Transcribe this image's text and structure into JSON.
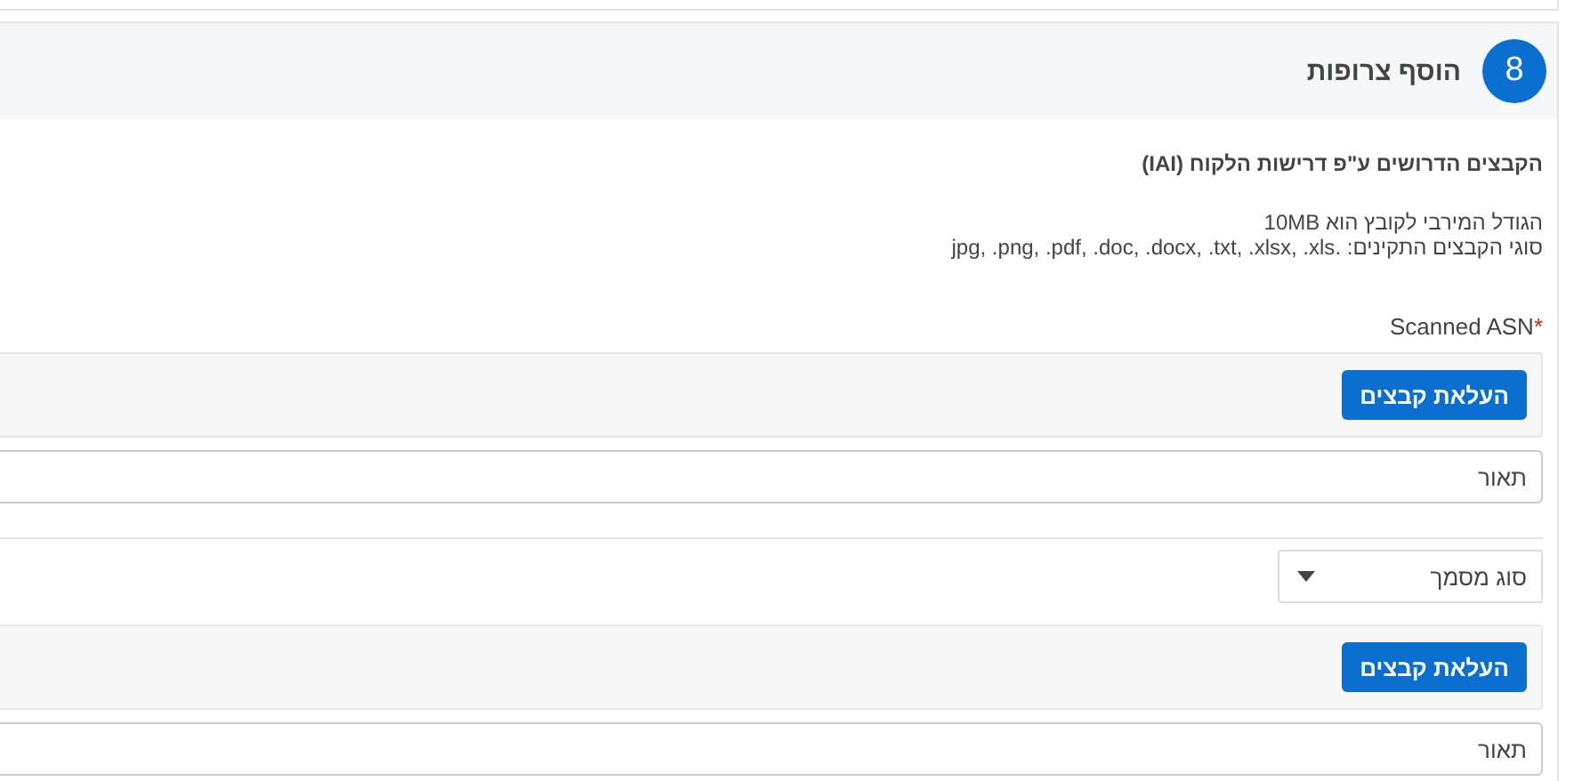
{
  "section": {
    "number": "8",
    "title": "הוסף צרופות"
  },
  "info": {
    "heading": "הקבצים הדרושים ע\"פ דרישות הלקוח (IAI)",
    "lines": [
      "הגודל המירבי לקובץ הוא 10MB",
      "סוגי הקבצים התקינים: .jpg, .png, .pdf, .doc, .docx, .txt, .xlsx, .xls"
    ]
  },
  "attachments": [
    {
      "kind": "label",
      "label": "Scanned ASN",
      "required": true,
      "required_mark": "*",
      "upload_button": "העלאת קבצים",
      "description_placeholder": "תאור"
    },
    {
      "kind": "select",
      "select_placeholder": "סוג מסמך",
      "upload_button": "העלאת קבצים",
      "description_placeholder": "תאור"
    }
  ]
}
